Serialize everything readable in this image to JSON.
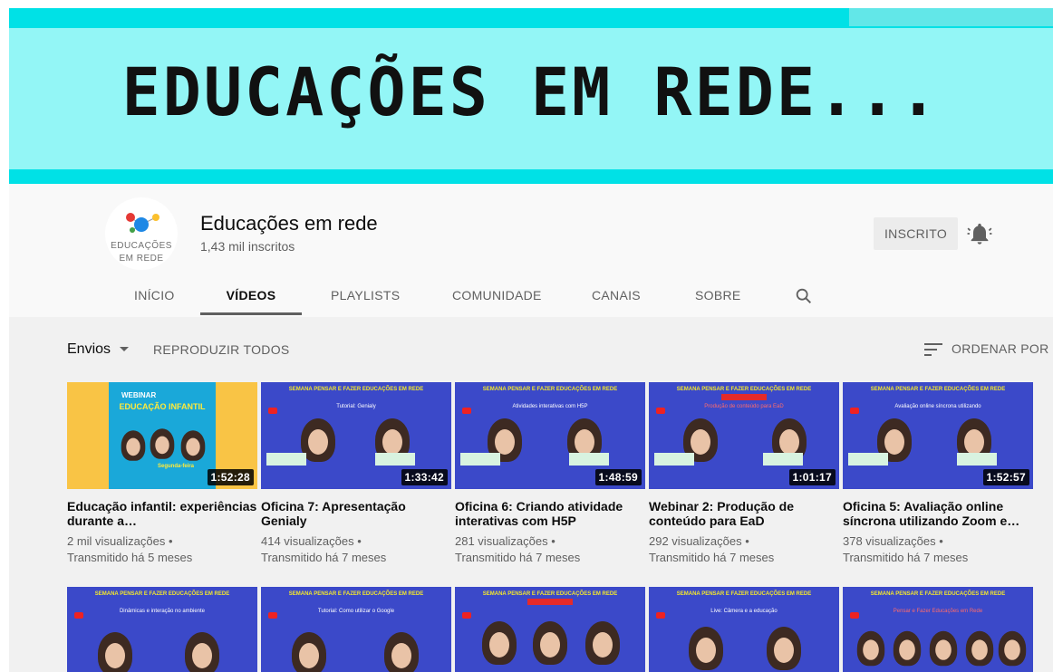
{
  "banner": {
    "title": "EDUCAÇÕES EM REDE..."
  },
  "channel": {
    "avatar_text_line1": "EDUCAÇÕES",
    "avatar_text_line2": "EM REDE",
    "name": "Educações em rede",
    "subscribers": "1,43 mil inscritos",
    "subscribe_label": "INSCRITO"
  },
  "tabs": [
    "INÍCIO",
    "VÍDEOS",
    "PLAYLISTS",
    "COMUNIDADE",
    "CANAIS",
    "SOBRE"
  ],
  "toolbar": {
    "sort_left": "Envios",
    "play_all": "REPRODUZIR TODOS",
    "sort_by": "ORDENAR POR"
  },
  "thumb_text": {
    "header": "SEMANA PENSAR E FAZER EDUCAÇÕES EM REDE",
    "webinar": "WEBINAR",
    "ei": "EDUCAÇÃO INFANTIL",
    "day": "Segunda-feira"
  },
  "videos_row1": [
    {
      "title": "Educação infantil: experiências durante a…",
      "views": "2 mil visualizações",
      "age": "Transmitido há 5 meses",
      "duration": "1:52:28",
      "sub": ""
    },
    {
      "title": "Oficina 7: Apresentação Genialy",
      "views": "414 visualizações",
      "age": "Transmitido há 7 meses",
      "duration": "1:33:42",
      "sub": "Tutorial: Genialy"
    },
    {
      "title": "Oficina 6: Criando atividade interativas com H5P",
      "views": "281 visualizações",
      "age": "Transmitido há 7 meses",
      "duration": "1:48:59",
      "sub": "Atividades interativas com H5P"
    },
    {
      "title": "Webinar 2: Produção de conteúdo para EaD",
      "views": "292 visualizações",
      "age": "Transmitido há 7 meses",
      "duration": "1:01:17",
      "sub": "Produção de conteúdo para EaD"
    },
    {
      "title": "Oficina 5: Avaliação online síncrona utilizando Zoom e…",
      "views": "378 visualizações",
      "age": "Transmitido há 7 meses",
      "duration": "1:52:57",
      "sub": "Avaliação online síncrona utilizando"
    }
  ],
  "videos_row2": [
    {
      "sub": "Dinâmicas e interação no ambiente"
    },
    {
      "sub": "Tutorial: Como utilizar o Google"
    },
    {
      "sub": ""
    },
    {
      "sub": "Live: Câmera e a educação"
    },
    {
      "sub": "Pensar e Fazer Educações em Rede"
    }
  ],
  "colors": {
    "banner_outer": "#00e1e6",
    "banner_inner": "#93f6f6",
    "thumb_blue": "#3b49c9",
    "thumb_header_text": "#f3e72d"
  }
}
